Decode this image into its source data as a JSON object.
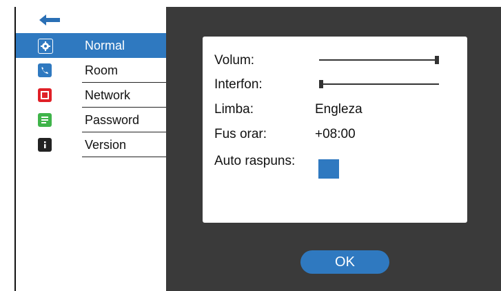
{
  "sidebar": {
    "back_icon": "arrow-left-icon",
    "items": [
      {
        "label": "Normal",
        "icon": "gear-icon",
        "color": "#2f79c0",
        "active": true
      },
      {
        "label": "Room",
        "icon": "phone-icon",
        "color": "#2f79c0",
        "active": false
      },
      {
        "label": "Network",
        "icon": "square-icon",
        "color": "#e02027",
        "active": false
      },
      {
        "label": "Password",
        "icon": "document-icon",
        "color": "#3fb44a",
        "active": false
      },
      {
        "label": "Version",
        "icon": "info-icon",
        "color": "#222222",
        "active": false
      }
    ]
  },
  "settings": {
    "volum": {
      "label": "Volum:",
      "level": 1.0
    },
    "interfon": {
      "label": "Interfon:",
      "level": 0.0
    },
    "limba": {
      "label": "Limba:",
      "value": "Engleza"
    },
    "fus_orar": {
      "label": "Fus orar:",
      "value": "+08:00"
    },
    "auto_raspuns": {
      "label": "Auto raspuns:",
      "enabled": true
    }
  },
  "ok_label": "OK",
  "colors": {
    "accent": "#2f79c0",
    "main_bg": "#3a3a3a"
  }
}
